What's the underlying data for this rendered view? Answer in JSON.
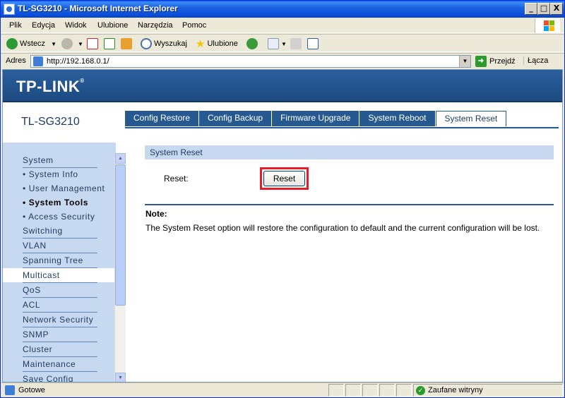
{
  "window": {
    "title": "TL-SG3210 - Microsoft Internet Explorer",
    "controls": [
      "_",
      "□",
      "X"
    ]
  },
  "menubar": {
    "items": [
      "Plik",
      "Edycja",
      "Widok",
      "Ulubione",
      "Narzędzia",
      "Pomoc"
    ]
  },
  "toolbar": {
    "back_label": "Wstecz",
    "search_label": "Wyszukaj",
    "favorites_label": "Ulubione"
  },
  "addressbar": {
    "label": "Adres",
    "url": "http://192.168.0.1/",
    "go_label": "Przejdź",
    "links_label": "Łącza"
  },
  "page": {
    "brand": "TP-LINK",
    "model": "TL-SG3210",
    "tabs": [
      {
        "label": "Config Restore",
        "active": false
      },
      {
        "label": "Config Backup",
        "active": false
      },
      {
        "label": "Firmware Upgrade",
        "active": false
      },
      {
        "label": "System Reboot",
        "active": false
      },
      {
        "label": "System Reset",
        "active": true
      }
    ],
    "sidebar": {
      "items": [
        {
          "label": "System",
          "type": "main"
        },
        {
          "label": "• System Info",
          "type": "sub"
        },
        {
          "label": "• User Management",
          "type": "sub"
        },
        {
          "label": "• System Tools",
          "type": "sub",
          "selected": true
        },
        {
          "label": "• Access Security",
          "type": "sub"
        },
        {
          "label": "Switching",
          "type": "main"
        },
        {
          "label": "VLAN",
          "type": "main"
        },
        {
          "label": "Spanning Tree",
          "type": "main"
        },
        {
          "label": "Multicast",
          "type": "main"
        },
        {
          "label": "QoS",
          "type": "main"
        },
        {
          "label": "ACL",
          "type": "main"
        },
        {
          "label": "Network Security",
          "type": "main"
        },
        {
          "label": "SNMP",
          "type": "main"
        },
        {
          "label": "Cluster",
          "type": "main"
        },
        {
          "label": "Maintenance",
          "type": "main"
        },
        {
          "label": "Save Config",
          "type": "main"
        }
      ]
    },
    "section_title": "System Reset",
    "reset_label": "Reset:",
    "reset_button": "Reset",
    "note_title": "Note:",
    "note_text": "The System Reset option will restore the configuration to default and the current configuration will be lost."
  },
  "statusbar": {
    "text": "Gotowe",
    "zone": "Zaufane witryny"
  },
  "colors": {
    "header_blue": "#25598f",
    "sidebar_bg": "#c6d9f1",
    "highlight_red": "#e31d2a"
  }
}
